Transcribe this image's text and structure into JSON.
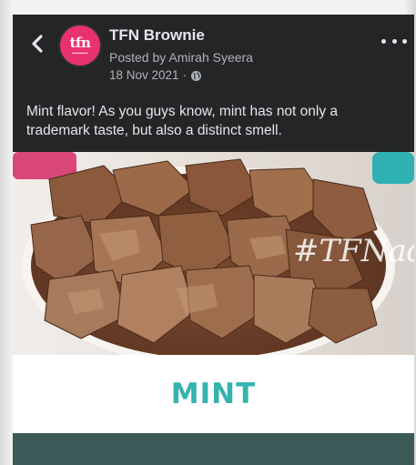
{
  "post": {
    "page_name": "TFN Brownie",
    "posted_by": "Posted by Amirah Syeera",
    "date": "18 Nov 2021",
    "separator": "·",
    "avatar_text": "tfn",
    "caption": "Mint flavor! As you guys know, mint has not only a trademark taste, but also a distinct smell."
  },
  "image": {
    "watermark": "#TFNadd",
    "flavor_label": "MINT"
  },
  "icons": {
    "back": "chevron-left-icon",
    "more": "more-horizontal-icon",
    "privacy": "globe-icon"
  },
  "colors": {
    "background": "#242526",
    "avatar": "#e8326d",
    "flavor_text": "#36b3ad",
    "bottom_bar": "#3c5a58"
  }
}
